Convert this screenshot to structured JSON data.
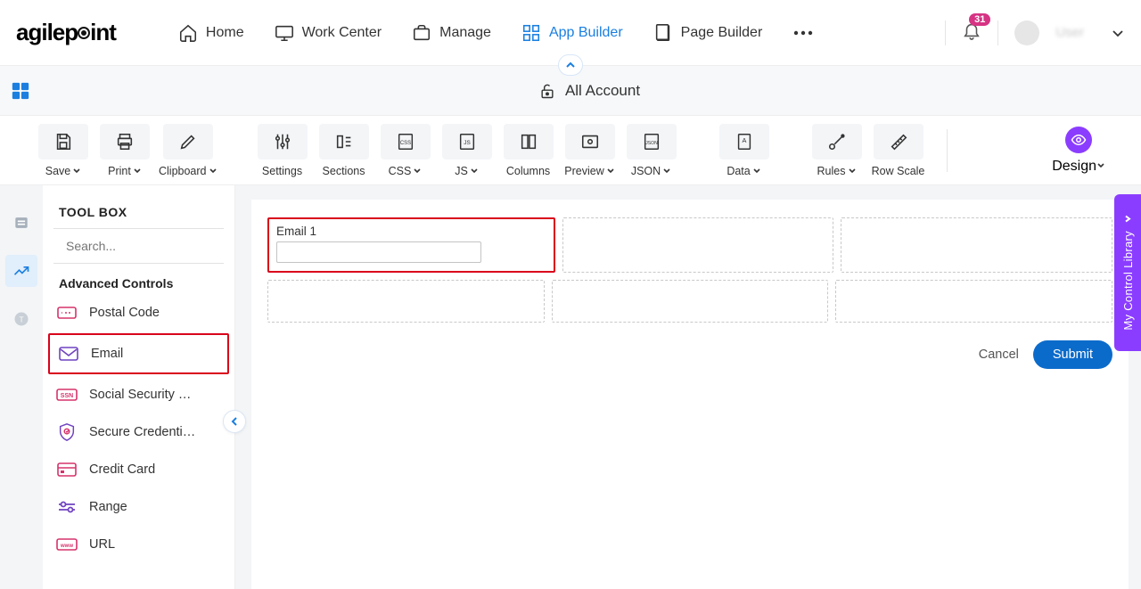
{
  "nav": {
    "home": "Home",
    "work_center": "Work Center",
    "manage": "Manage",
    "app_builder": "App Builder",
    "page_builder": "Page Builder",
    "badge": "31",
    "user": "User"
  },
  "breadcrumb": {
    "title": "All Account"
  },
  "toolbar": {
    "save": "Save",
    "print": "Print",
    "clipboard": "Clipboard",
    "settings": "Settings",
    "sections": "Sections",
    "css": "CSS",
    "js": "JS",
    "columns": "Columns",
    "preview": "Preview",
    "json": "JSON",
    "data": "Data",
    "rules": "Rules",
    "row_scale": "Row Scale",
    "design": "Design"
  },
  "toolbox": {
    "title": "TOOL BOX",
    "search_placeholder": "Search...",
    "section": "Advanced Controls",
    "items": {
      "postal_code": "Postal Code",
      "email": "Email",
      "ssn": "Social Security …",
      "secure": "Secure Credenti…",
      "credit": "Credit Card",
      "range": "Range",
      "url": "URL"
    }
  },
  "form": {
    "field_label": "Email 1",
    "cancel": "Cancel",
    "submit": "Submit"
  },
  "side_panel": "My Control Library"
}
